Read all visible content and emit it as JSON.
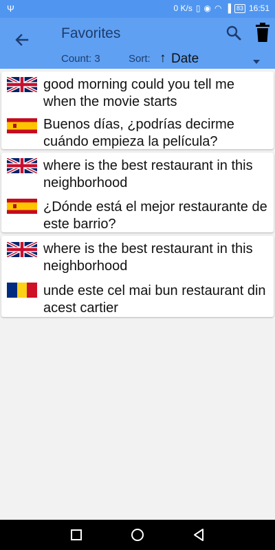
{
  "status_bar": {
    "network_speed": "0 K/s",
    "battery": "83",
    "time": "16:51"
  },
  "header": {
    "title": "Favorites",
    "count_text": "Count: 3",
    "sort_label": "Sort:",
    "sort_arrow": "↑",
    "sort_value": "Date"
  },
  "favorites": [
    {
      "source": {
        "flag": "flag-uk-icon",
        "text": "good morning could you tell me when the movie starts"
      },
      "target": {
        "flag": "flag-spain-icon",
        "text": "Buenos días, ¿podrías decirme cuándo empieza la película?"
      }
    },
    {
      "source": {
        "flag": "flag-uk-icon",
        "text": "where is the best restaurant in this neighborhood"
      },
      "target": {
        "flag": "flag-spain-icon",
        "text": "¿Dónde está el mejor restaurante de este barrio?"
      }
    },
    {
      "source": {
        "flag": "flag-uk-icon",
        "text": "where is the best restaurant in this neighborhood"
      },
      "target": {
        "flag": "flag-romania-icon",
        "text": "unde este cel mai bun restaurant din acest cartier"
      }
    }
  ],
  "colors": {
    "status_bar": "#5096f0",
    "app_bar": "#5fa0f2",
    "title_text": "#1e3c6e",
    "background": "#f2f2f2"
  }
}
